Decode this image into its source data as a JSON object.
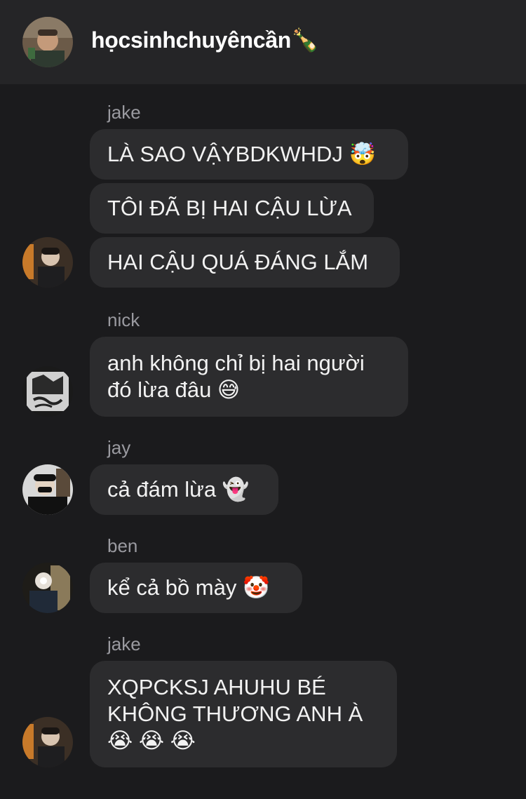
{
  "header": {
    "title": "họcsinhchuyêncần🍾"
  },
  "messages": [
    {
      "sender": "jake",
      "texts": [
        "LÀ SAO VẬYBDKWHDJ 🤯",
        "TÔI ĐÃ BỊ HAI CẬU LỪA",
        "HAI CẬU QUÁ ĐÁNG LẮM"
      ]
    },
    {
      "sender": "nick",
      "texts": [
        "anh không chỉ bị hai người\nđó lừa đâu 😅"
      ]
    },
    {
      "sender": "jay",
      "texts": [
        "cả đám lừa 👻"
      ]
    },
    {
      "sender": "ben",
      "texts": [
        "kể cả bồ mày 🤡"
      ]
    },
    {
      "sender": "jake",
      "texts": [
        "XQPCKSJ AHUHU BÉ\nKHÔNG THƯƠNG ANH À\n😭 😭 😭"
      ]
    }
  ],
  "colors": {
    "background": "#1b1b1d",
    "header": "#252527",
    "bubble": "#2c2c2e",
    "sender_name": "#9a9aa0"
  }
}
